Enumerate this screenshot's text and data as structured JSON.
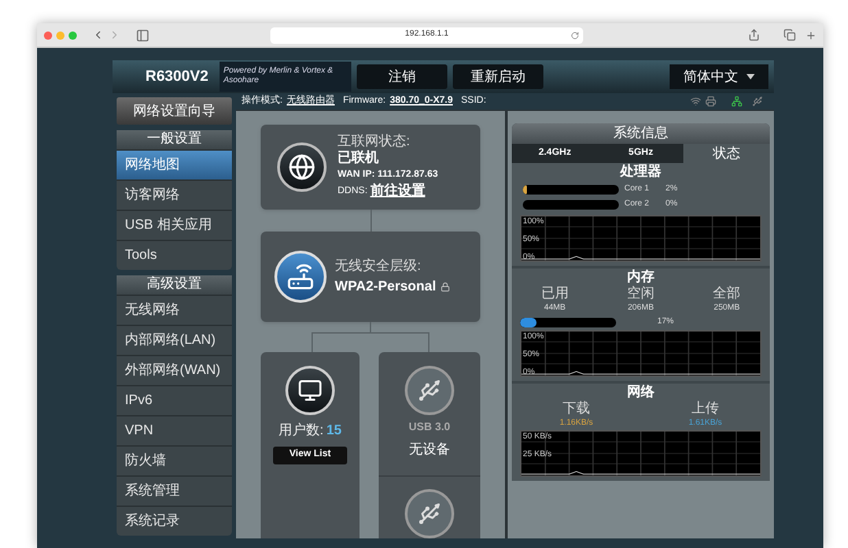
{
  "browser": {
    "url": "192.168.1.1"
  },
  "header": {
    "model": "R6300V2",
    "logo_text": "Powered by Merlin & Vortex & Asoohare",
    "buttons": [
      "注销",
      "重新启动"
    ],
    "language": "简体中文"
  },
  "status_line": {
    "mode_label": "操作模式:",
    "mode": "无线路由器",
    "firmware_label": "Firmware:",
    "firmware": "380.70_0-X7.9",
    "ssid_label": "SSID:"
  },
  "sidebar": {
    "wizard": "网络设置向导",
    "sections": [
      {
        "title": "一般设置",
        "items": [
          {
            "label": "网络地图",
            "selected": true
          },
          {
            "label": "访客网络",
            "selected": false
          },
          {
            "label": "USB 相关应用",
            "selected": false
          },
          {
            "label": "Tools",
            "selected": false
          }
        ]
      },
      {
        "title": "高级设置",
        "items": [
          {
            "label": "无线网络",
            "selected": false
          },
          {
            "label": "内部网络(LAN)",
            "selected": false
          },
          {
            "label": "外部网络(WAN)",
            "selected": false
          },
          {
            "label": "IPv6",
            "selected": false
          },
          {
            "label": "VPN",
            "selected": false
          },
          {
            "label": "防火墙",
            "selected": false
          },
          {
            "label": "系统管理",
            "selected": false
          },
          {
            "label": "系统记录",
            "selected": false
          }
        ]
      }
    ]
  },
  "map": {
    "internet": {
      "status_label": "互联网状态:",
      "status": "已联机",
      "wan_ip": "WAN IP: 111.172.87.63",
      "ddns_label": "DDNS:",
      "ddns_link": "前往设置"
    },
    "wireless": {
      "label": "无线安全层级:",
      "value": "WPA2-Personal"
    },
    "clients": {
      "label": "用户数:",
      "count": "15",
      "button": "View List"
    },
    "usb": {
      "label": "USB 3.0",
      "status": "无设备"
    }
  },
  "system_info": {
    "title": "系统信息",
    "tabs": [
      {
        "label": "2.4GHz",
        "selected": false
      },
      {
        "label": "5GHz",
        "selected": false
      },
      {
        "label": "状态",
        "selected": true
      }
    ],
    "cpu": {
      "title": "处理器",
      "cores": [
        {
          "name": "Core 1",
          "level": 0.02,
          "reading": "2%"
        },
        {
          "name": "Core 2",
          "level": 0,
          "reading": "0%"
        }
      ],
      "graph_labels": [
        "100%",
        "50%",
        "0%"
      ]
    },
    "memory": {
      "title": "内存",
      "stats": [
        {
          "label": "已用",
          "value": "44MB"
        },
        {
          "label": "空闲",
          "value": "206MB"
        },
        {
          "label": "全部",
          "value": "250MB"
        }
      ],
      "level": 0.17,
      "reading": "17%",
      "graph_labels": [
        "100%",
        "50%",
        "0%"
      ]
    },
    "network": {
      "title": "网络",
      "rates": [
        {
          "label": "下载",
          "value": "1.16KB/s",
          "color": "#d9a441"
        },
        {
          "label": "上传",
          "value": "1.61KB/s",
          "color": "#49a3d6"
        }
      ],
      "graph_labels": [
        "50 KB/s",
        "25 KB/s"
      ]
    }
  }
}
